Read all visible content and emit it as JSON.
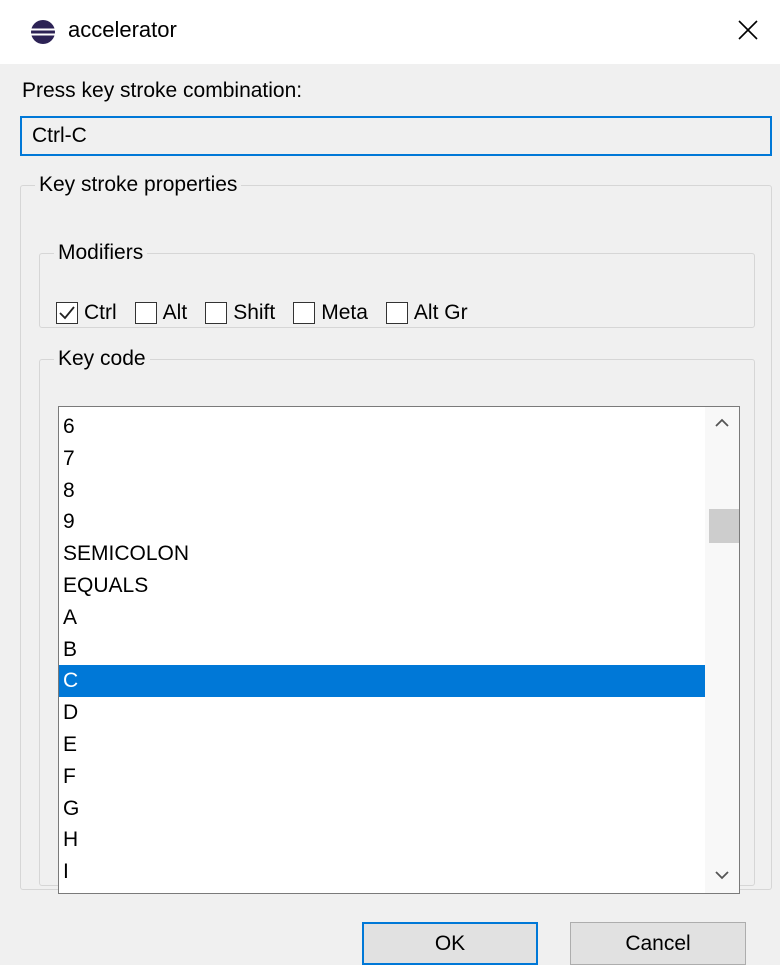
{
  "window": {
    "title": "accelerator",
    "icon": "eclipse-icon",
    "close_icon": "close-icon"
  },
  "prompt": {
    "label": "Press key stroke combination:",
    "value": "Ctrl-C"
  },
  "properties": {
    "legend": "Key stroke properties",
    "modifiers": {
      "legend": "Modifiers",
      "items": [
        {
          "label": "Ctrl",
          "checked": true
        },
        {
          "label": "Alt",
          "checked": false
        },
        {
          "label": "Shift",
          "checked": false
        },
        {
          "label": "Meta",
          "checked": false
        },
        {
          "label": "Alt Gr",
          "checked": false
        }
      ]
    },
    "keycode": {
      "legend": "Key code",
      "items": [
        "6",
        "7",
        "8",
        "9",
        "SEMICOLON",
        "EQUALS",
        "A",
        "B",
        "C",
        "D",
        "E",
        "F",
        "G",
        "H",
        "I"
      ],
      "selected": "C"
    }
  },
  "buttons": {
    "ok": "OK",
    "cancel": "Cancel"
  },
  "colors": {
    "accent": "#0078d7",
    "dialog_bg": "#f0f0f0",
    "selection_bg": "#0078d7"
  }
}
